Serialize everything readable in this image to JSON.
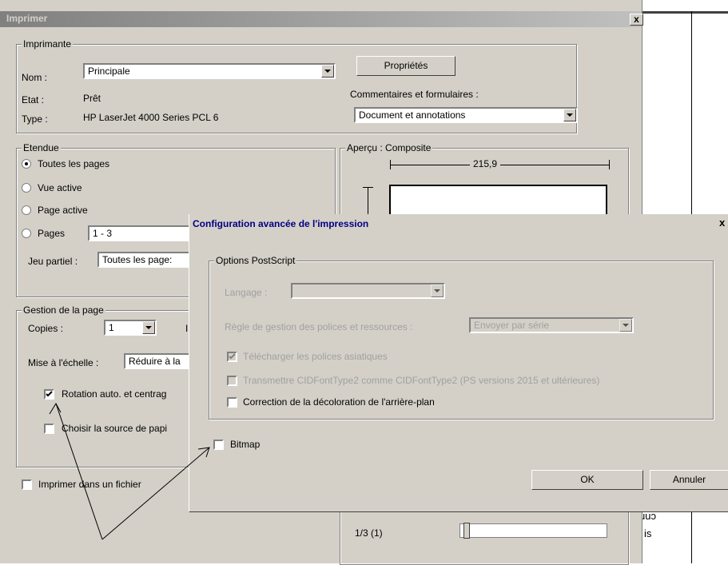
{
  "print_dialog": {
    "title": "Imprimer",
    "printer_group": "Imprimante",
    "name_label": "Nom :",
    "name_value": "Principale",
    "state_label": "Etat :",
    "state_value": "Prêt",
    "type_label": "Type :",
    "type_value": "HP LaserJet 4000 Series PCL 6",
    "properties_button": "Propriétés",
    "comments_label": "Commentaires et formulaires :",
    "comments_value": "Document et annotations",
    "range_group": "Etendue",
    "range_all": "Toutes les pages",
    "range_view": "Vue active",
    "range_current": "Page active",
    "range_pages": "Pages",
    "range_pages_value": "1 - 3",
    "subset_label": "Jeu partiel :",
    "subset_value": "Toutes les page:",
    "preview_group": "Aperçu : Composite",
    "preview_width": "215,9",
    "page_mgmt_group": "Gestion de la page",
    "copies_label": "Copies :",
    "copies_value": "1",
    "scale_label": "Mise à l'échelle :",
    "scale_value": "Réduire à la",
    "auto_rotate_label": "Rotation auto. et centrag",
    "auto_rotate_checked": true,
    "paper_source_label": "Choisir la source de papi",
    "paper_source_checked": false,
    "print_to_file_label": "Imprimer dans un fichier",
    "print_to_file_checked": false,
    "page_counter": "1/3 (1)",
    "partial_label": "I"
  },
  "advanced_dialog": {
    "title": "Configuration avancée de l'impression",
    "postscript_group": "Options PostScript",
    "language_label": "Langage :",
    "font_rule_label": "Règle de gestion des polices et ressources :",
    "font_rule_value": "Envoyer par série",
    "download_asian_label": "Télécharger les polices asiatiques",
    "download_asian_checked": true,
    "cid_label": "Transmettre CIDFontType2 comme CIDFontType2 (PS versions 2015 et ultérieures)",
    "cid_checked": false,
    "bg_correction_label": "Correction de la décoloration de l'arrière-plan",
    "bg_correction_checked": false,
    "bitmap_label": "Bitmap",
    "bitmap_checked": false,
    "ok_button": "OK",
    "cancel_button": "Annuler",
    "close_glyph": "x"
  },
  "background_fragments": {
    "text_a": "uuɔ",
    "text_b": "is"
  },
  "close_glyph": "x"
}
